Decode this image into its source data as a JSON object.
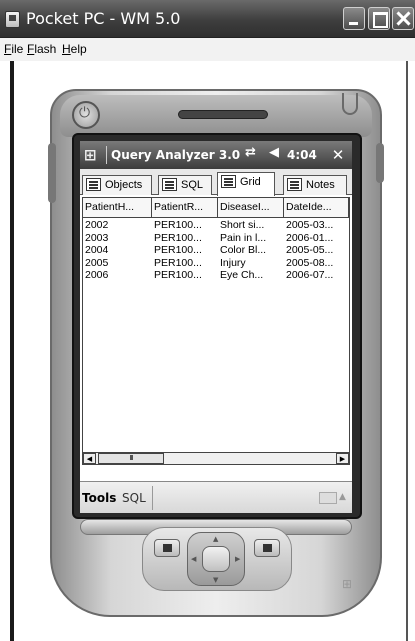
{
  "window": {
    "title": "Pocket PC - WM 5.0",
    "menu": [
      "File",
      "Flash",
      "Help"
    ]
  },
  "device_screen": {
    "title": "Query Analyzer 3.0",
    "clock": "4:04",
    "ok_label": "✕",
    "tabs": [
      {
        "label": "Objects",
        "active": false
      },
      {
        "label": "SQL",
        "active": false
      },
      {
        "label": "Grid",
        "active": true
      },
      {
        "label": "Notes",
        "active": false
      }
    ],
    "grid": {
      "columns": [
        "PatientH...",
        "PatientR...",
        "DiseaseI...",
        "DateIde..."
      ],
      "rows": [
        [
          "2002",
          "PER100...",
          "Short si...",
          "2005-03..."
        ],
        [
          "2003",
          "PER100...",
          "Pain in l...",
          "2006-01..."
        ],
        [
          "2004",
          "PER100...",
          "Color Bl...",
          "2005-05..."
        ],
        [
          "2005",
          "PER100...",
          "Injury",
          "2005-08..."
        ],
        [
          "2006",
          "PER100...",
          "Eye Ch...",
          "2006-07..."
        ]
      ],
      "scroll_thumb": "III"
    },
    "menu_bar": {
      "tools_label": "Tools",
      "sql_label": "SQL"
    }
  },
  "icons": {
    "start": "windows-flag-icon",
    "connectivity": "connectivity-icon",
    "volume": "speaker-icon",
    "keyboard": "keyboard-icon"
  },
  "colors": {
    "titlebar": "#3e3e3e",
    "screen_bg": "#ffffff",
    "device_body": "#d6d6d6"
  }
}
